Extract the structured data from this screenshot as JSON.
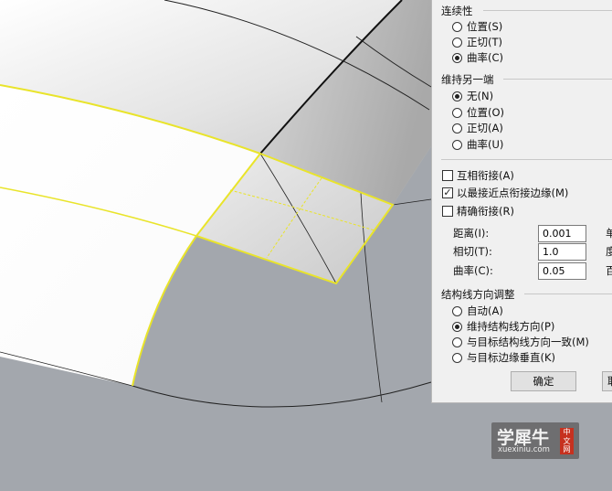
{
  "continuity": {
    "title": "连续性",
    "options": [
      {
        "label": "位置(S)",
        "selected": false
      },
      {
        "label": "正切(T)",
        "selected": false
      },
      {
        "label": "曲率(C)",
        "selected": true
      }
    ]
  },
  "maintain_other_end": {
    "title": "维持另一端",
    "options": [
      {
        "label": "无(N)",
        "selected": true
      },
      {
        "label": "位置(O)",
        "selected": false
      },
      {
        "label": "正切(A)",
        "selected": false
      },
      {
        "label": "曲率(U)",
        "selected": false
      }
    ]
  },
  "checkboxes": [
    {
      "label": "互相衔接(A)",
      "checked": false
    },
    {
      "label": "以最接近点衔接边缘(M)",
      "checked": true
    },
    {
      "label": "精确衔接(R)",
      "checked": false
    }
  ],
  "tolerances": [
    {
      "label": "距离(I):",
      "value": "0.001",
      "unit": "单"
    },
    {
      "label": "相切(T):",
      "value": "1.0",
      "unit": "度"
    },
    {
      "label": "曲率(C):",
      "value": "0.05",
      "unit": "百"
    }
  ],
  "isocurve_direction": {
    "title": "结构线方向调整",
    "options": [
      {
        "label": "自动(A)",
        "selected": false
      },
      {
        "label": "维持结构线方向(P)",
        "selected": true
      },
      {
        "label": "与目标结构线方向一致(M)",
        "selected": false
      },
      {
        "label": "与目标边缘垂直(K)",
        "selected": false
      }
    ]
  },
  "buttons": {
    "ok": "确定",
    "cancel": "取"
  },
  "watermark": {
    "title": "学犀牛",
    "site": "xuexiniu.com",
    "seal": "中文网"
  },
  "colors": {
    "highlight_edge": "#e9e42a",
    "viewport_bg": "#a3a7ad",
    "panel_bg": "#f0f0f0"
  }
}
